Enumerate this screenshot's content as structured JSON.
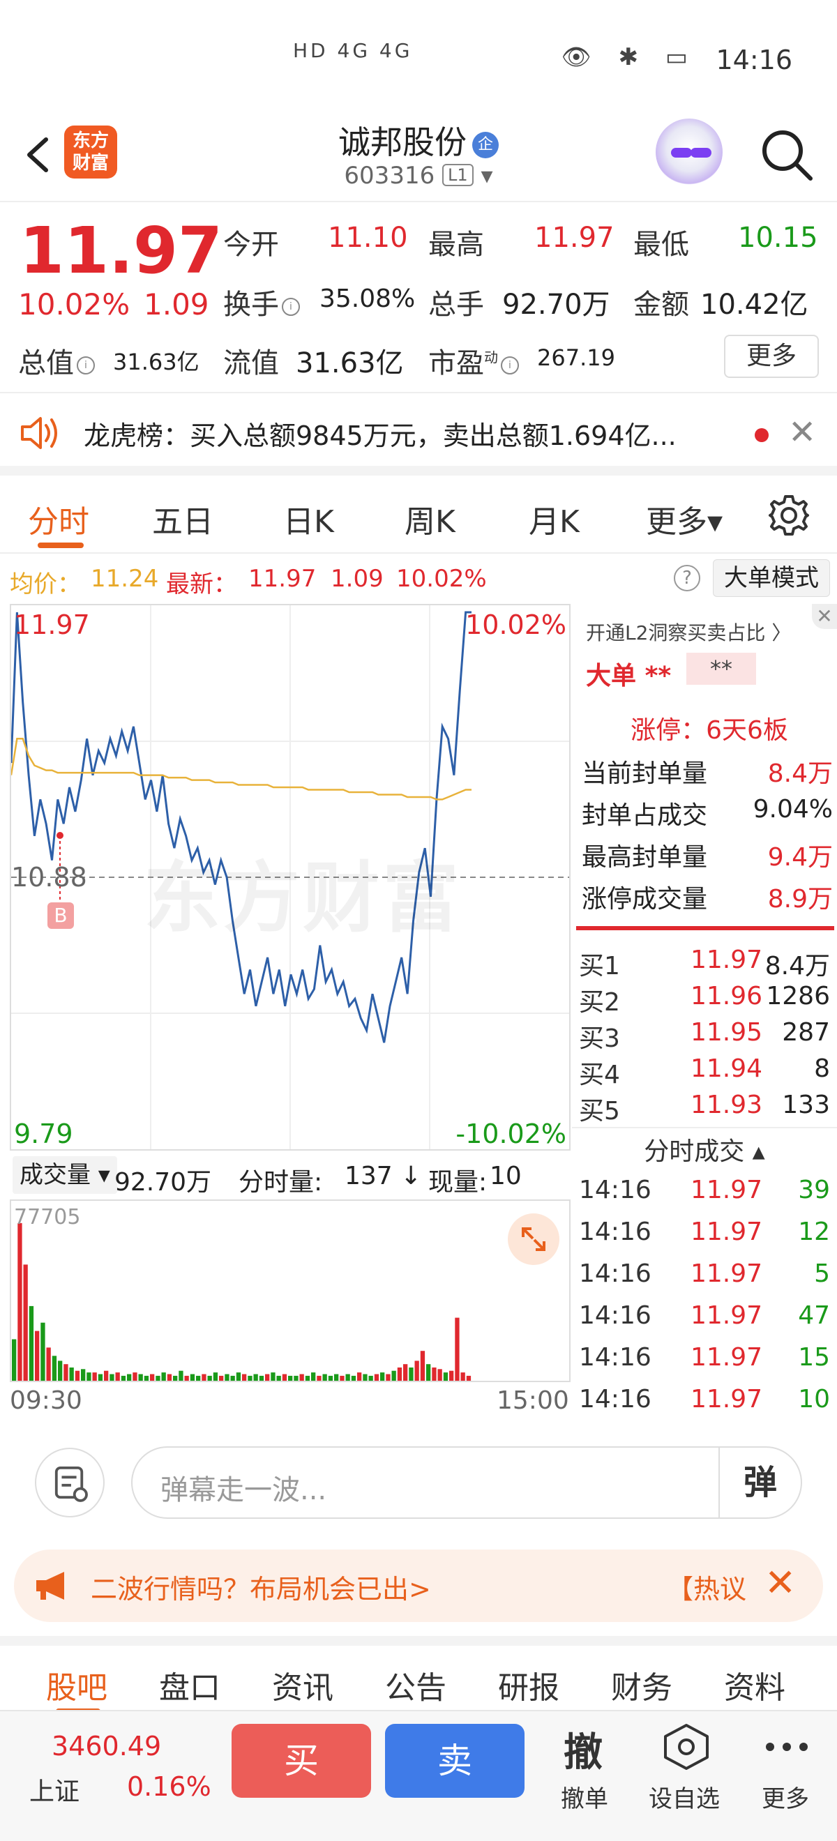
{
  "status_bar": {
    "time": "14:16",
    "signals": "HD 4G 4G",
    "icons": "👁 ✱ ▭"
  },
  "header": {
    "logo_text": "东方财富",
    "stock_name": "诚邦股份",
    "name_badge": "企",
    "code": "603316",
    "level": "L1"
  },
  "quote": {
    "price": "11.97",
    "change_pct": "10.02%",
    "change": "1.09",
    "fields": {
      "open_label": "今开",
      "open": "11.10",
      "high_label": "最高",
      "high": "11.97",
      "low_label": "最低",
      "low": "10.15",
      "turnover_label": "换手",
      "turnover": "35.08%",
      "volume_label": "总手",
      "volume": "92.70万",
      "amount_label": "金额",
      "amount": "10.42亿",
      "mktcap_label": "总值",
      "mktcap": "31.63亿",
      "float_label": "流值",
      "float": "31.63亿",
      "pe_label": "市盈",
      "pe_sup": "动",
      "pe": "267.19"
    },
    "more_label": "更多"
  },
  "banner": {
    "text": "龙虎榜：买入总额9845万元，卖出总额1.694亿..."
  },
  "tabs": [
    "分时",
    "五日",
    "日K",
    "周K",
    "月K",
    "更多▾"
  ],
  "info_line": {
    "avg_label": "均价：",
    "avg": "11.24",
    "latest_label": "最新：",
    "latest": "11.97",
    "chg": "1.09",
    "pct": "10.02%",
    "help": "?",
    "mode_btn": "大单模式"
  },
  "chart_labels": {
    "top_price": "11.97",
    "top_pct": "10.02%",
    "mid_price": "10.88",
    "bottom_price": "9.79",
    "bottom_pct": "-10.02%",
    "marker": "B",
    "watermark": "东方财富"
  },
  "chart_data": {
    "type": "line",
    "ylim": [
      9.79,
      11.97
    ],
    "prev_close": 10.88,
    "x_start": "09:30",
    "x_end": "15:00",
    "series": [
      {
        "name": "price",
        "color": "#2d5fa8",
        "values": [
          11.35,
          11.97,
          11.6,
          11.3,
          11.05,
          11.2,
          11.1,
          10.95,
          11.2,
          11.1,
          11.25,
          11.15,
          11.28,
          11.45,
          11.3,
          11.4,
          11.35,
          11.45,
          11.38,
          11.48,
          11.4,
          11.5,
          11.35,
          11.2,
          11.28,
          11.15,
          11.3,
          11.1,
          11.0,
          11.12,
          11.05,
          10.95,
          11.0,
          10.9,
          10.95,
          10.85,
          10.95,
          10.88,
          10.7,
          10.55,
          10.4,
          10.5,
          10.35,
          10.45,
          10.55,
          10.4,
          10.5,
          10.35,
          10.48,
          10.4,
          10.5,
          10.38,
          10.42,
          10.6,
          10.45,
          10.5,
          10.4,
          10.45,
          10.35,
          10.38,
          10.3,
          10.25,
          10.4,
          10.3,
          10.2,
          10.35,
          10.45,
          10.55,
          10.4,
          10.7,
          10.9,
          11.0,
          10.8,
          11.2,
          11.5,
          11.45,
          11.3,
          11.65,
          11.97,
          11.97
        ]
      },
      {
        "name": "avg",
        "color": "#e8b23a",
        "values": [
          11.3,
          11.45,
          11.45,
          11.38,
          11.34,
          11.33,
          11.32,
          11.32,
          11.31,
          11.31,
          11.31,
          11.31,
          11.31,
          11.31,
          11.31,
          11.31,
          11.31,
          11.31,
          11.31,
          11.31,
          11.31,
          11.31,
          11.3,
          11.3,
          11.3,
          11.3,
          11.3,
          11.29,
          11.29,
          11.29,
          11.29,
          11.28,
          11.28,
          11.28,
          11.28,
          11.27,
          11.27,
          11.27,
          11.27,
          11.26,
          11.26,
          11.26,
          11.26,
          11.26,
          11.26,
          11.25,
          11.25,
          11.25,
          11.25,
          11.25,
          11.25,
          11.24,
          11.24,
          11.24,
          11.24,
          11.24,
          11.24,
          11.24,
          11.23,
          11.23,
          11.23,
          11.23,
          11.23,
          11.22,
          11.22,
          11.22,
          11.22,
          11.22,
          11.21,
          11.21,
          11.21,
          11.21,
          11.21,
          11.2,
          11.2,
          11.21,
          11.22,
          11.23,
          11.24,
          11.24
        ]
      }
    ],
    "volume": {
      "max_label": "77705",
      "bars": [
        {
          "v": 0.25,
          "c": "g"
        },
        {
          "v": 0.95,
          "c": "r"
        },
        {
          "v": 0.7,
          "c": "r"
        },
        {
          "v": 0.45,
          "c": "g"
        },
        {
          "v": 0.3,
          "c": "r"
        },
        {
          "v": 0.35,
          "c": "g"
        },
        {
          "v": 0.2,
          "c": "r"
        },
        {
          "v": 0.15,
          "c": "g"
        },
        {
          "v": 0.12,
          "c": "g"
        },
        {
          "v": 0.1,
          "c": "r"
        },
        {
          "v": 0.08,
          "c": "g"
        },
        {
          "v": 0.06,
          "c": "r"
        },
        {
          "v": 0.07,
          "c": "g"
        },
        {
          "v": 0.05,
          "c": "g"
        },
        {
          "v": 0.05,
          "c": "r"
        },
        {
          "v": 0.04,
          "c": "g"
        },
        {
          "v": 0.06,
          "c": "r"
        },
        {
          "v": 0.04,
          "c": "g"
        },
        {
          "v": 0.05,
          "c": "r"
        },
        {
          "v": 0.03,
          "c": "g"
        },
        {
          "v": 0.04,
          "c": "g"
        },
        {
          "v": 0.05,
          "c": "r"
        },
        {
          "v": 0.04,
          "c": "g"
        },
        {
          "v": 0.03,
          "c": "g"
        },
        {
          "v": 0.04,
          "c": "r"
        },
        {
          "v": 0.03,
          "c": "g"
        },
        {
          "v": 0.05,
          "c": "g"
        },
        {
          "v": 0.04,
          "c": "r"
        },
        {
          "v": 0.03,
          "c": "g"
        },
        {
          "v": 0.06,
          "c": "g"
        },
        {
          "v": 0.03,
          "c": "r"
        },
        {
          "v": 0.04,
          "c": "g"
        },
        {
          "v": 0.03,
          "c": "g"
        },
        {
          "v": 0.04,
          "c": "r"
        },
        {
          "v": 0.03,
          "c": "g"
        },
        {
          "v": 0.05,
          "c": "g"
        },
        {
          "v": 0.03,
          "c": "r"
        },
        {
          "v": 0.04,
          "c": "g"
        },
        {
          "v": 0.03,
          "c": "g"
        },
        {
          "v": 0.05,
          "c": "g"
        },
        {
          "v": 0.04,
          "c": "r"
        },
        {
          "v": 0.03,
          "c": "g"
        },
        {
          "v": 0.04,
          "c": "g"
        },
        {
          "v": 0.03,
          "c": "g"
        },
        {
          "v": 0.04,
          "c": "r"
        },
        {
          "v": 0.05,
          "c": "g"
        },
        {
          "v": 0.03,
          "c": "g"
        },
        {
          "v": 0.04,
          "c": "r"
        },
        {
          "v": 0.03,
          "c": "g"
        },
        {
          "v": 0.03,
          "c": "g"
        },
        {
          "v": 0.04,
          "c": "r"
        },
        {
          "v": 0.03,
          "c": "g"
        },
        {
          "v": 0.05,
          "c": "g"
        },
        {
          "v": 0.03,
          "c": "r"
        },
        {
          "v": 0.04,
          "c": "g"
        },
        {
          "v": 0.03,
          "c": "g"
        },
        {
          "v": 0.04,
          "c": "g"
        },
        {
          "v": 0.03,
          "c": "r"
        },
        {
          "v": 0.04,
          "c": "g"
        },
        {
          "v": 0.03,
          "c": "g"
        },
        {
          "v": 0.05,
          "c": "r"
        },
        {
          "v": 0.04,
          "c": "g"
        },
        {
          "v": 0.03,
          "c": "g"
        },
        {
          "v": 0.04,
          "c": "r"
        },
        {
          "v": 0.05,
          "c": "g"
        },
        {
          "v": 0.04,
          "c": "r"
        },
        {
          "v": 0.06,
          "c": "g"
        },
        {
          "v": 0.08,
          "c": "r"
        },
        {
          "v": 0.1,
          "c": "r"
        },
        {
          "v": 0.08,
          "c": "g"
        },
        {
          "v": 0.12,
          "c": "r"
        },
        {
          "v": 0.18,
          "c": "r"
        },
        {
          "v": 0.1,
          "c": "g"
        },
        {
          "v": 0.08,
          "c": "r"
        },
        {
          "v": 0.07,
          "c": "r"
        },
        {
          "v": 0.05,
          "c": "g"
        },
        {
          "v": 0.06,
          "c": "r"
        },
        {
          "v": 0.38,
          "c": "r"
        },
        {
          "v": 0.05,
          "c": "r"
        },
        {
          "v": 0.03,
          "c": "r"
        }
      ]
    }
  },
  "right_panel": {
    "header": "开通L2洞察买卖占比 〉",
    "close": "✕",
    "big_label": "大单",
    "big_val1": "**",
    "big_val2": "**",
    "limit_text": "涨停：6天6板",
    "stats": [
      {
        "label": "当前封单量",
        "value": "8.4万",
        "color": "red"
      },
      {
        "label": "封单占成交",
        "value": "9.04%",
        "color": "black"
      },
      {
        "label": "最高封单量",
        "value": "9.4万",
        "color": "red"
      },
      {
        "label": "涨停成交量",
        "value": "8.9万",
        "color": "red"
      }
    ],
    "order_book": [
      {
        "side": "买1",
        "price": "11.97",
        "qty": "8.4万"
      },
      {
        "side": "买2",
        "price": "11.96",
        "qty": "1286"
      },
      {
        "side": "买3",
        "price": "11.95",
        "qty": "287"
      },
      {
        "side": "买4",
        "price": "11.94",
        "qty": "8"
      },
      {
        "side": "买5",
        "price": "11.93",
        "qty": "133"
      }
    ],
    "ticks_title": "分时成交 ▴",
    "ticks": [
      {
        "time": "14:16",
        "price": "11.97",
        "qty": "39"
      },
      {
        "time": "14:16",
        "price": "11.97",
        "qty": "12"
      },
      {
        "time": "14:16",
        "price": "11.97",
        "qty": "5"
      },
      {
        "time": "14:16",
        "price": "11.97",
        "qty": "47"
      },
      {
        "time": "14:16",
        "price": "11.97",
        "qty": "15"
      },
      {
        "time": "14:16",
        "price": "11.97",
        "qty": "10"
      }
    ]
  },
  "volume_bar": {
    "select": "成交量 ▾",
    "total": "92.70万",
    "minute_label": "分时量:",
    "minute": "137 ↓",
    "now_label": "现量:",
    "now": "10"
  },
  "danmaku": {
    "placeholder": "弹幕走一波...",
    "button": "弹"
  },
  "promo": {
    "text": "二波行情吗？布局机会已出>",
    "hot": "【热议",
    "close": "✕"
  },
  "bottom_tabs": [
    "股吧",
    "盘口",
    "资讯",
    "公告",
    "研报",
    "财务",
    "资料"
  ],
  "actions": {
    "index_value": "3460.49",
    "index_name": "上证",
    "index_pct": "0.16%",
    "buy": "买",
    "sell": "卖",
    "cancel_glyph": "撤",
    "cancel": "撤单",
    "watch": "设自选",
    "more": "更多"
  }
}
